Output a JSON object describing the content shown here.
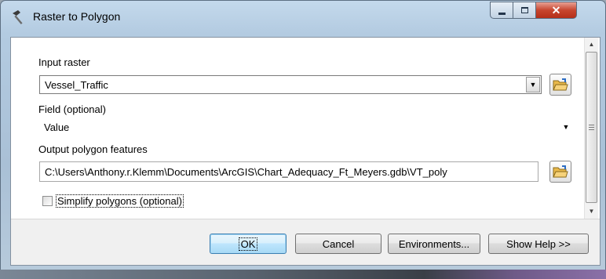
{
  "window": {
    "title": "Raster to Polygon",
    "icon": "hammer-icon",
    "controls": {
      "minimize": "minimize-icon",
      "maximize": "maximize-icon",
      "close": "close-icon"
    }
  },
  "form": {
    "input_raster": {
      "label": "Input raster",
      "value": "Vessel_Traffic"
    },
    "field": {
      "label": "Field (optional)",
      "value": "Value"
    },
    "output": {
      "label": "Output polygon features",
      "value": "C:\\Users\\Anthony.r.Klemm\\Documents\\ArcGIS\\Chart_Adequacy_Ft_Meyers.gdb\\VT_poly"
    },
    "simplify": {
      "label": "Simplify polygons (optional)",
      "checked": false
    }
  },
  "buttons": {
    "ok": "OK",
    "cancel": "Cancel",
    "environments": "Environments...",
    "show_help": "Show Help >>"
  },
  "colors": {
    "accent": "#3c7fb1",
    "close": "#c7452e",
    "folder": "#e8b84a"
  }
}
